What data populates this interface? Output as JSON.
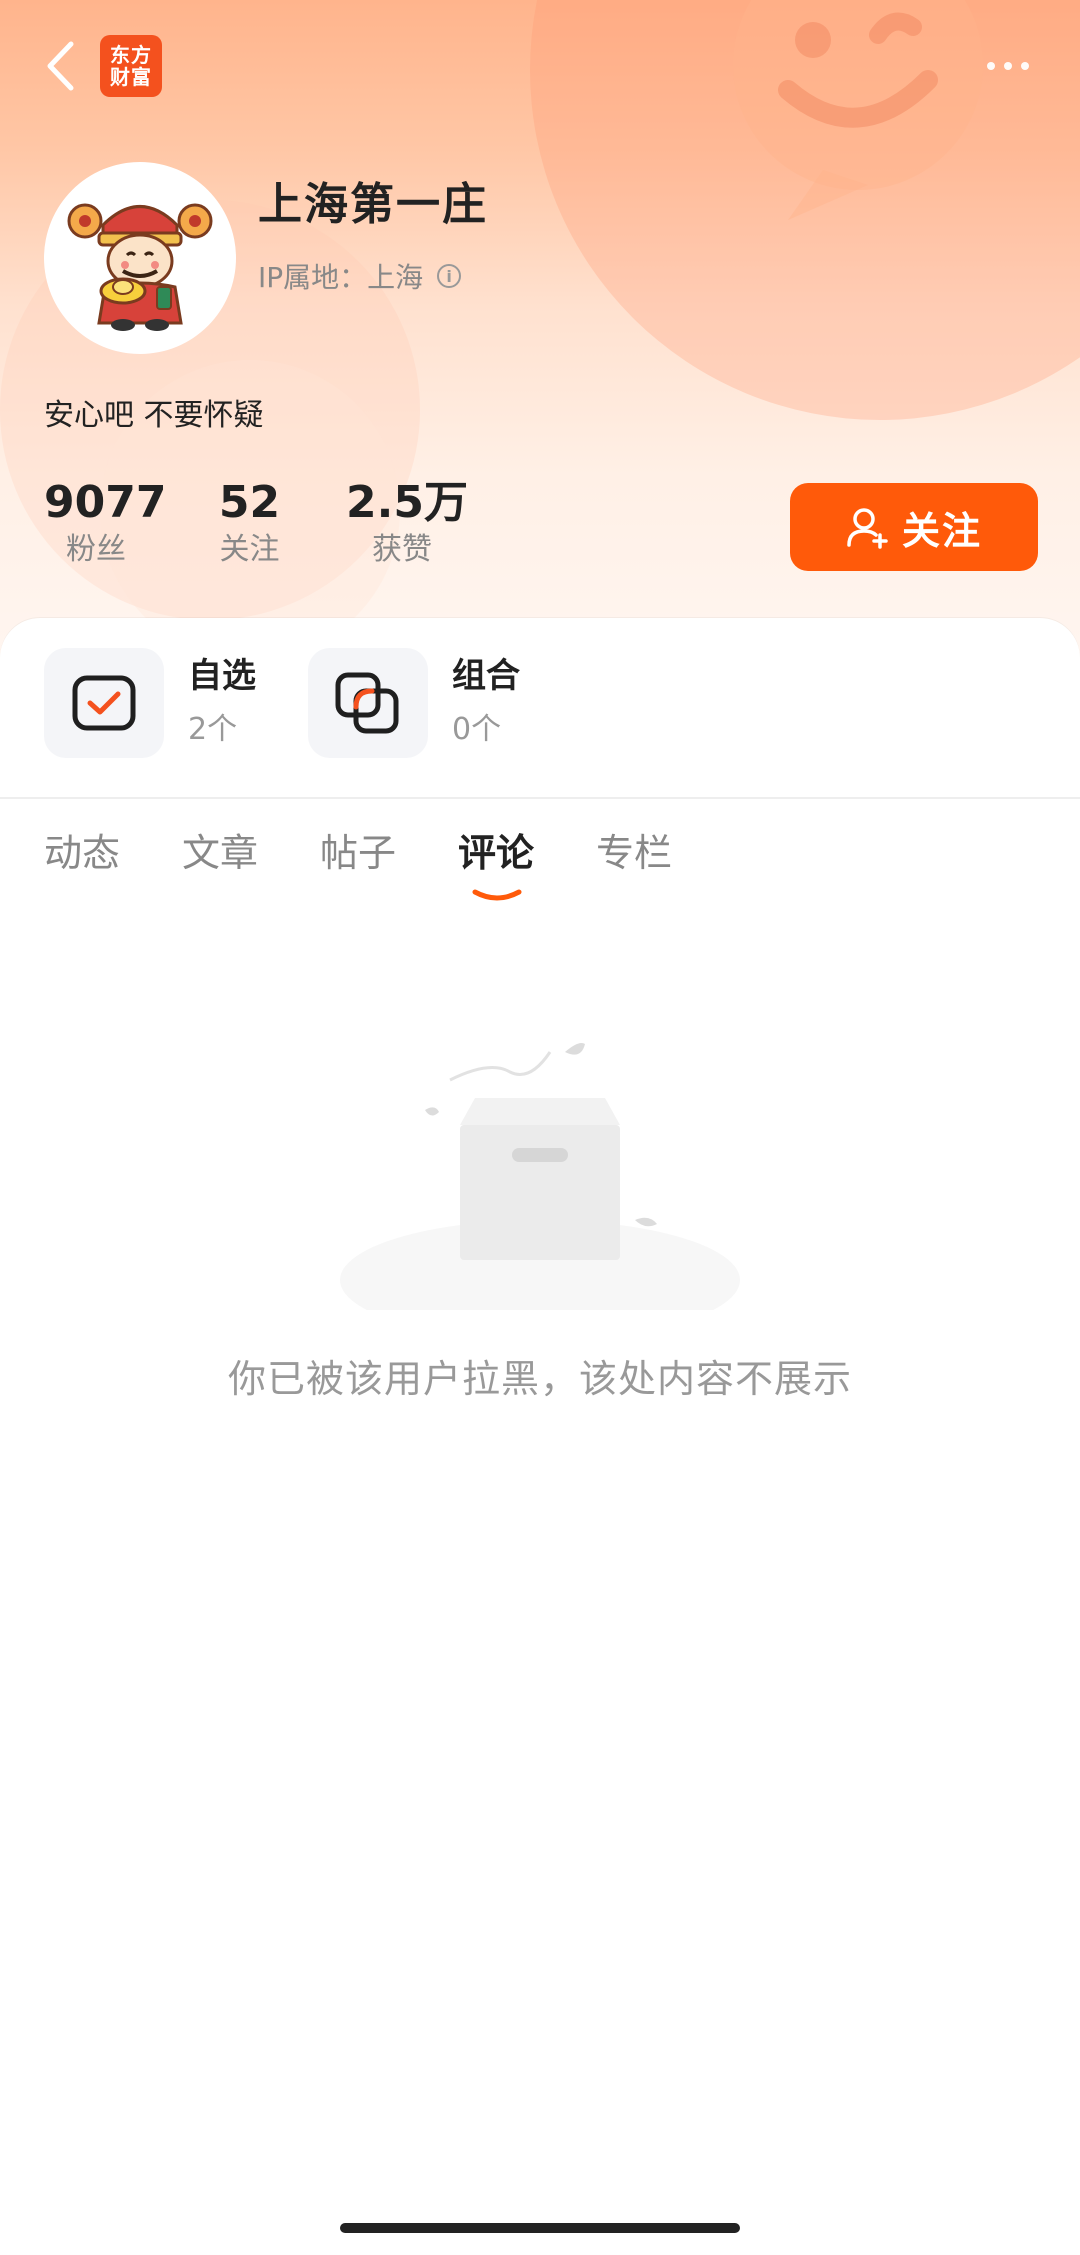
{
  "header": {
    "logo_line1": "东方",
    "logo_line2": "财富"
  },
  "profile": {
    "username": "上海第一庄",
    "ip_location": "IP属地：上海",
    "bio": "安心吧 不要怀疑"
  },
  "stats": [
    {
      "value": "9077",
      "label": "粉丝"
    },
    {
      "value": "52",
      "label": "关注"
    },
    {
      "value": "2.5万",
      "label": "获赞"
    }
  ],
  "follow_button": {
    "label": "关注"
  },
  "quick_links": [
    {
      "title": "自选",
      "count": "2个",
      "icon": "watchlist-check-icon"
    },
    {
      "title": "组合",
      "count": "0个",
      "icon": "portfolio-icon"
    }
  ],
  "tabs": [
    {
      "label": "动态",
      "active": false
    },
    {
      "label": "文章",
      "active": false
    },
    {
      "label": "帖子",
      "active": false
    },
    {
      "label": "评论",
      "active": true
    },
    {
      "label": "专栏",
      "active": false
    }
  ],
  "empty_state": {
    "message": "你已被该用户拉黑，该处内容不展示"
  },
  "colors": {
    "accent": "#ff5a0a",
    "brand": "#f4511e",
    "hero_top": "#ffb48c"
  }
}
